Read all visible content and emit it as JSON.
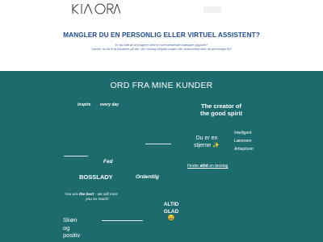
{
  "logo": {
    "text": "KIA ORA"
  },
  "hero": {
    "title": "MANGLER DU EN PERSONLIG ELLER VIRTUEL ASSISTENT?",
    "lines": [
      "Er du træt af at jonglere med en overvældende mængde opgaver?",
      "Savner du tid til at fokusere på det, der virkelig betyder noget i din virksomhed eller dit personlige liv?"
    ]
  },
  "testimonials": {
    "title": "ORD FRA MINE KUNDER",
    "inspire": "inspire",
    "every_day": "every day",
    "creator_line1": "The creator of",
    "creator_line2": "the good spirit",
    "intelligent": "Intelligent",
    "laerenem": "Lærenem",
    "arbejdsom": "Arbejdsom",
    "stjerne_line1": "Du er en",
    "stjerne_line2": "stjerne ✨",
    "link_prefix": "Finder",
    "link_bold": "altid",
    "link_suffix": "en løsning",
    "fed": "Fed",
    "bosslady": "BOSSLADY",
    "ordentlig": "Ordentlig",
    "best_pre": "You are",
    "best_bold": "the best",
    "best_post": "- we will miss",
    "best_line2": "you so much!",
    "altid": "ALTID",
    "glad": "GLAD",
    "smile": "😀",
    "skon_line1": "Skøn",
    "skon_line2": "og",
    "skon_line3": "positiv"
  },
  "colors": {
    "teal": "#1e6b6e",
    "heading_blue": "#1d4a8f",
    "subtitle_blue": "#3f6aa8"
  }
}
